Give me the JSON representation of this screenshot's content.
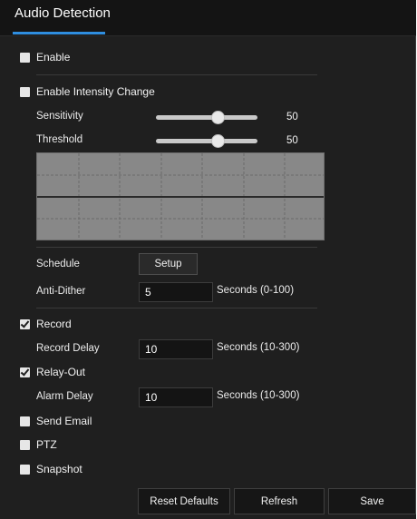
{
  "tab": {
    "title": "Audio Detection"
  },
  "enable": {
    "label": "Enable",
    "checked": false
  },
  "intensity": {
    "label": "Enable Intensity Change",
    "checked": false
  },
  "sensitivity": {
    "label": "Sensitivity",
    "value": "50",
    "level": 50
  },
  "threshold": {
    "label": "Threshold",
    "value": "50",
    "level": 50
  },
  "schedule": {
    "label": "Schedule",
    "button": "Setup"
  },
  "anti_dither": {
    "label": "Anti-Dither",
    "value": "5",
    "suffix": "Seconds (0-100)"
  },
  "record": {
    "label": "Record",
    "checked": true
  },
  "record_delay": {
    "label": "Record Delay",
    "value": "10",
    "suffix": "Seconds (10-300)"
  },
  "relay_out": {
    "label": "Relay-Out",
    "checked": true
  },
  "alarm_delay": {
    "label": "Alarm Delay",
    "value": "10",
    "suffix": "Seconds (10-300)"
  },
  "send_email": {
    "label": "Send Email",
    "checked": false
  },
  "ptz": {
    "label": "PTZ",
    "checked": false
  },
  "snapshot": {
    "label": "Snapshot",
    "checked": false
  },
  "footer": {
    "reset": "Reset Defaults",
    "refresh": "Refresh",
    "save": "Save"
  },
  "colors": {
    "accent": "#2f8ee0",
    "panel": "#1f1f1f",
    "graph": "#888888"
  }
}
